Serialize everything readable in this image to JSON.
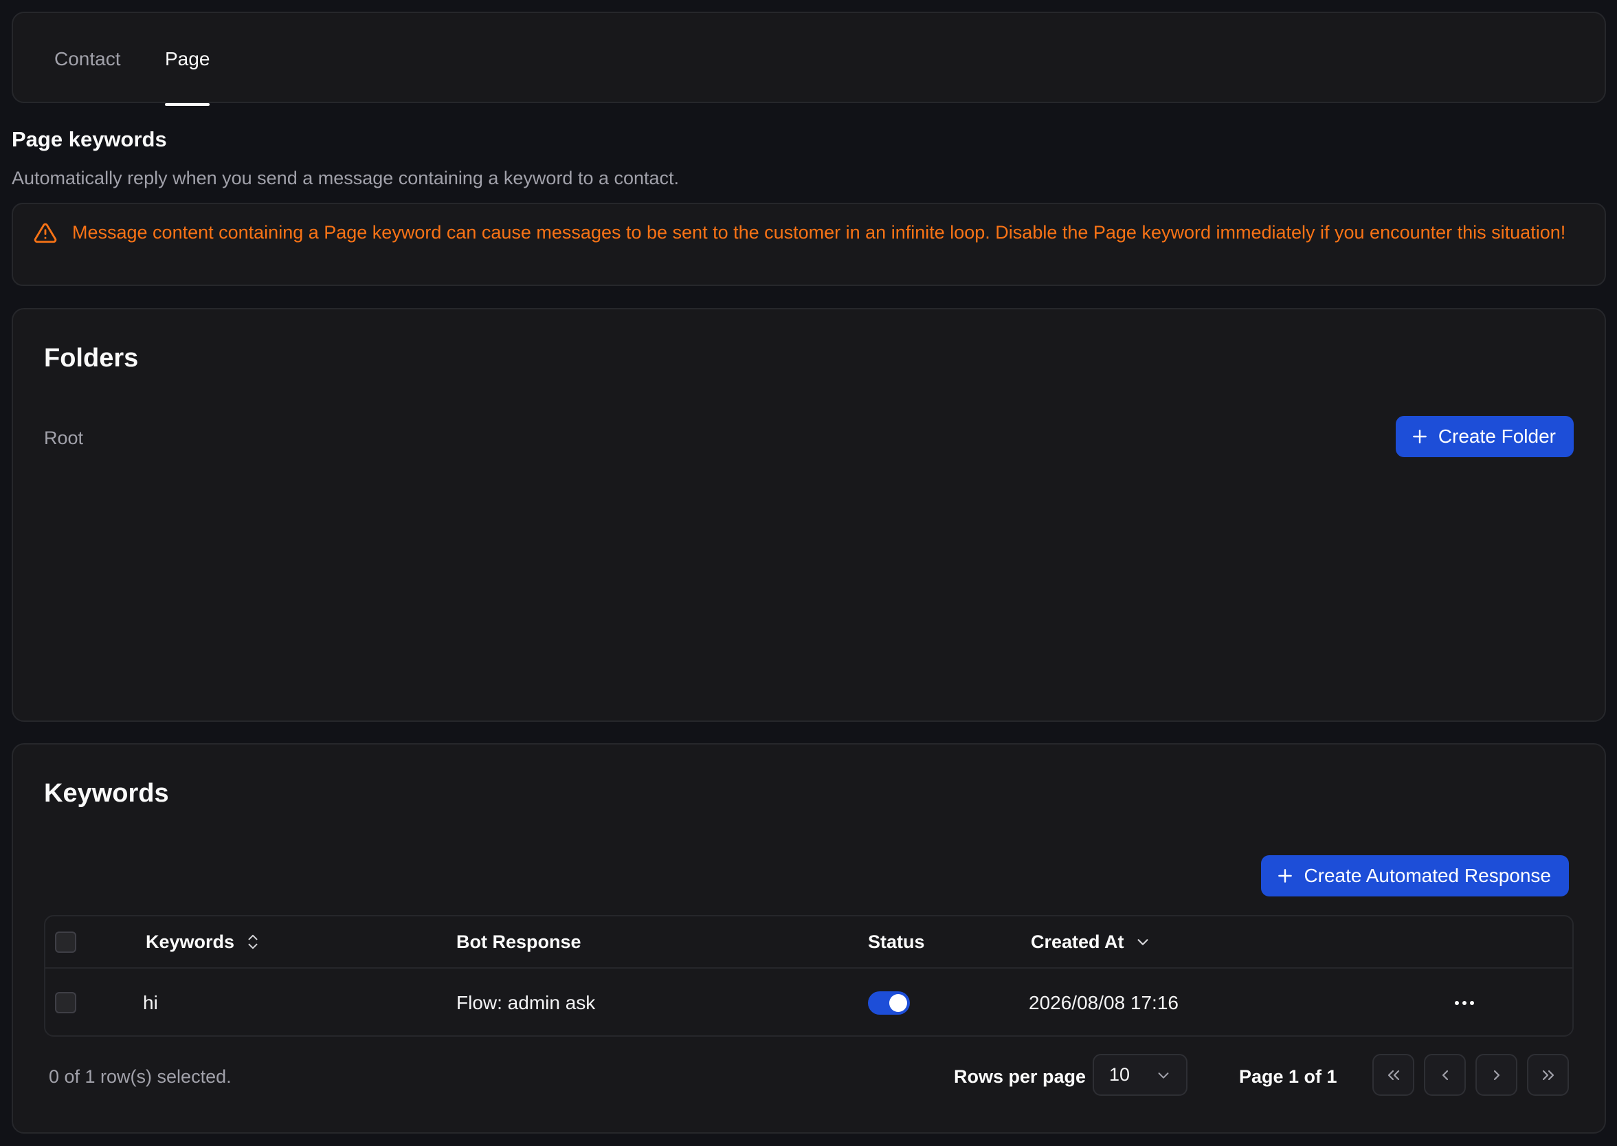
{
  "tabs": [
    {
      "label": "Contact",
      "active": false
    },
    {
      "label": "Page",
      "active": true
    }
  ],
  "section": {
    "title": "Page keywords",
    "description": "Automatically reply when you send a message containing a keyword to a contact."
  },
  "warning": {
    "icon": "alert-triangle-icon",
    "text": "Message content containing a Page keyword can cause messages to be sent to the customer in an infinite loop. Disable the Page keyword immediately if you encounter this situation!",
    "color": "#f97316"
  },
  "folders": {
    "title": "Folders",
    "root_label": "Root",
    "create_button": "Create Folder"
  },
  "keywords": {
    "title": "Keywords",
    "create_button": "Create Automated Response",
    "columns": [
      "Keywords",
      "Bot Response",
      "Status",
      "Created At"
    ],
    "rows": [
      {
        "keyword": "hi",
        "bot_response": "Flow: admin ask",
        "status": true,
        "created_at": "2026/08/08 17:16"
      }
    ],
    "footer": {
      "selected_text": "0 of 1 row(s) selected.",
      "rows_per_page_label": "Rows per page",
      "rows_per_page_value": "10",
      "page_info": "Page 1 of 1"
    }
  },
  "colors": {
    "accent": "#1d4ed8",
    "background": "#111217",
    "card": "#18181b",
    "warning": "#f97316"
  }
}
